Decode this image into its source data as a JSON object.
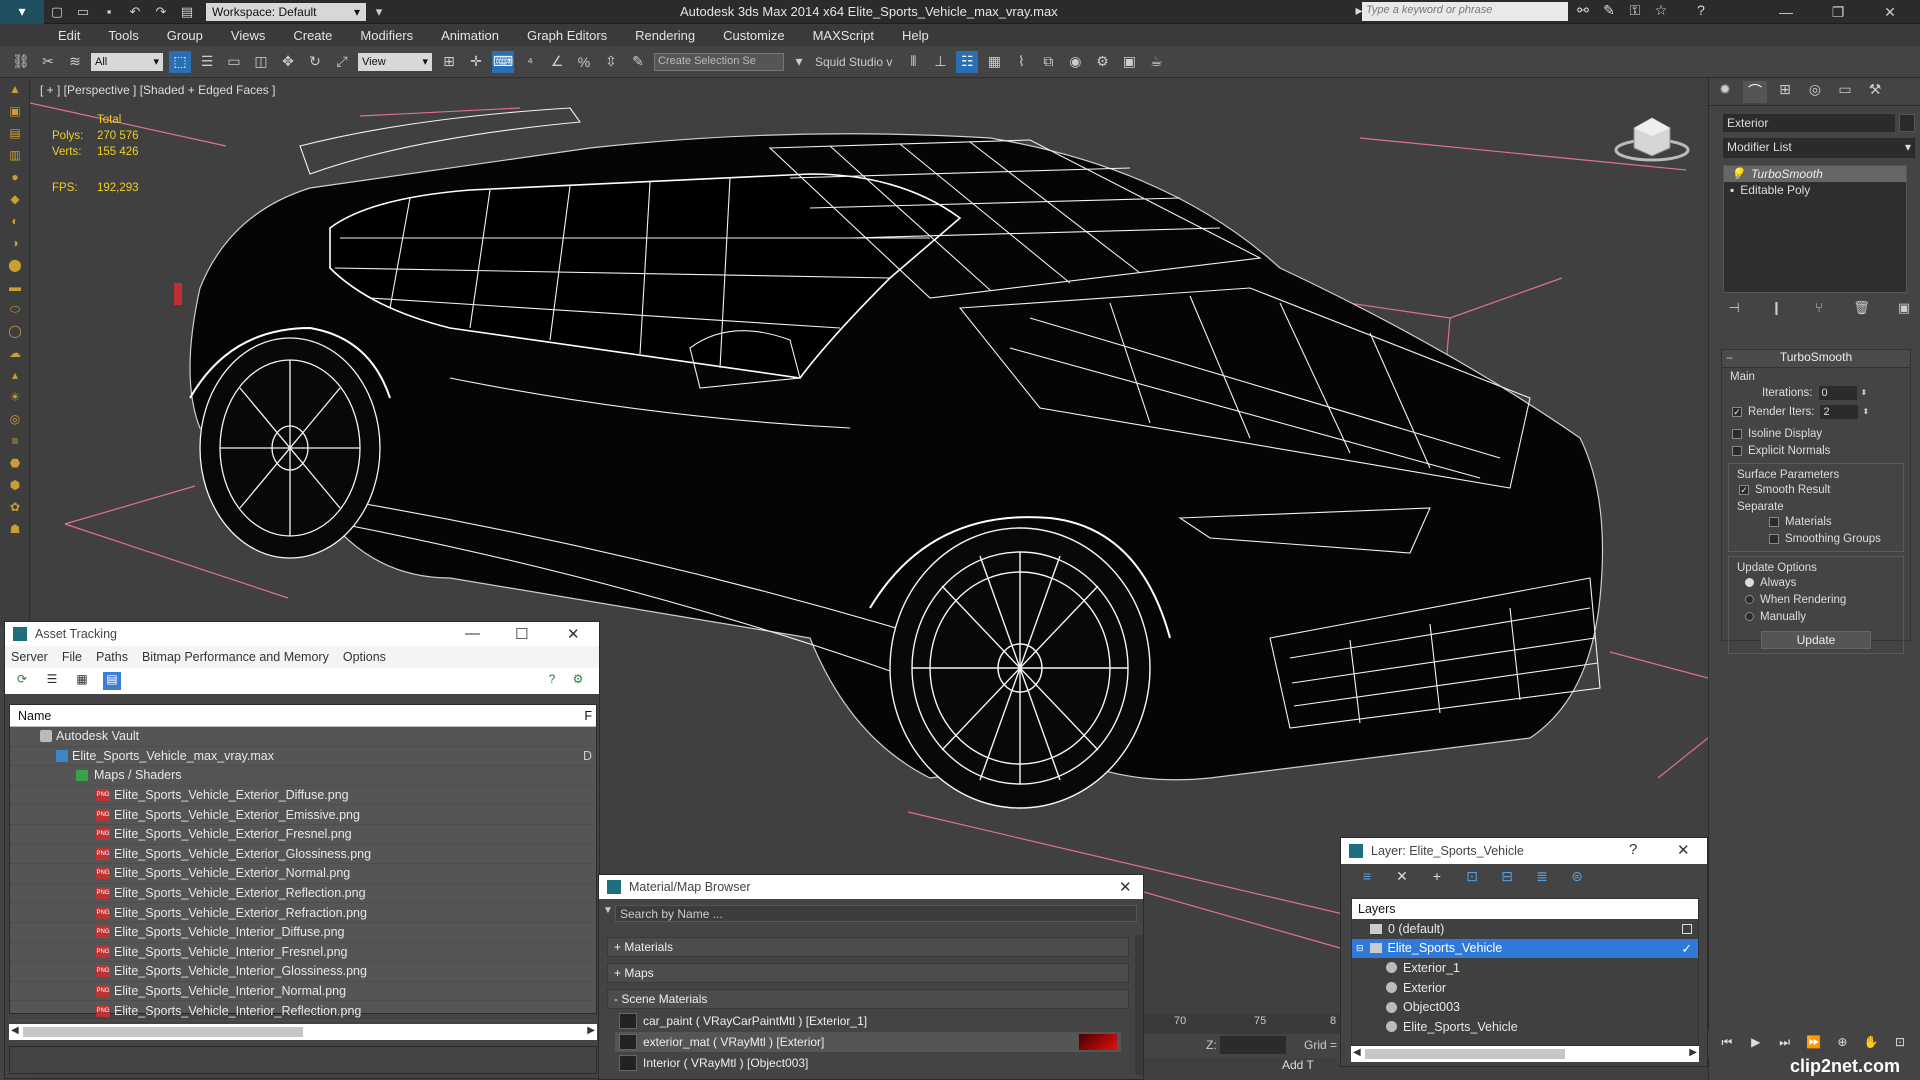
{
  "titlebar": {
    "workspace": "Workspace: Default",
    "window_title": "Autodesk 3ds Max  2014 x64      Elite_Sports_Vehicle_max_vray.max",
    "search_placeholder": "Type a keyword or phrase"
  },
  "menu": [
    "Edit",
    "Tools",
    "Group",
    "Views",
    "Create",
    "Modifiers",
    "Animation",
    "Graph Editors",
    "Rendering",
    "Customize",
    "MAXScript",
    "Help"
  ],
  "toolbar": {
    "filter": "All",
    "ref_coord": "View",
    "selection_set": "Create Selection Se",
    "squid": "Squid Studio v"
  },
  "viewport": {
    "label": "[ + ] [Perspective ] [Shaded + Edged Faces ]",
    "stats_total": "Total",
    "polys_label": "Polys:",
    "polys_value": "270 576",
    "verts_label": "Verts:",
    "verts_value": "155 426",
    "fps_label": "FPS:",
    "fps_value": "192,293"
  },
  "command_panel": {
    "object_name": "Exterior",
    "modifier_list": "Modifier List",
    "stack": [
      "TurboSmooth",
      "Editable Poly"
    ],
    "rollout_title": "TurboSmooth",
    "main_label": "Main",
    "iterations_label": "Iterations:",
    "iterations_value": "0",
    "render_iters_label": "Render Iters:",
    "render_iters_value": "2",
    "isoline_label": "Isoline Display",
    "explicit_label": "Explicit Normals",
    "surface_label": "Surface Parameters",
    "smooth_label": "Smooth Result",
    "separate_label": "Separate",
    "materials_label": "Materials",
    "smoothing_label": "Smoothing Groups",
    "update_options_label": "Update Options",
    "always_label": "Always",
    "when_rendering_label": "When Rendering",
    "manually_label": "Manually",
    "update_button": "Update"
  },
  "asset_tracking": {
    "title": "Asset Tracking",
    "menu": [
      "Server",
      "File",
      "Paths",
      "Bitmap Performance and Memory",
      "Options"
    ],
    "col_name": "Name",
    "col_f": "F",
    "vault": "Autodesk Vault",
    "max_file": "Elite_Sports_Vehicle_max_vray.max",
    "max_tag": "D",
    "maps_folder": "Maps / Shaders",
    "files": [
      "Elite_Sports_Vehicle_Exterior_Diffuse.png",
      "Elite_Sports_Vehicle_Exterior_Emissive.png",
      "Elite_Sports_Vehicle_Exterior_Fresnel.png",
      "Elite_Sports_Vehicle_Exterior_Glossiness.png",
      "Elite_Sports_Vehicle_Exterior_Normal.png",
      "Elite_Sports_Vehicle_Exterior_Reflection.png",
      "Elite_Sports_Vehicle_Exterior_Refraction.png",
      "Elite_Sports_Vehicle_Interior_Diffuse.png",
      "Elite_Sports_Vehicle_Interior_Fresnel.png",
      "Elite_Sports_Vehicle_Interior_Glossiness.png",
      "Elite_Sports_Vehicle_Interior_Normal.png",
      "Elite_Sports_Vehicle_Interior_Reflection.png"
    ]
  },
  "material_browser": {
    "title": "Material/Map Browser",
    "search_placeholder": "Search by Name ...",
    "sections": [
      "+ Materials",
      "+ Maps",
      "- Scene Materials"
    ],
    "materials": [
      "car_paint  ( VRayCarPaintMtl ) [Exterior_1]",
      "exterior_mat  ( VRayMtl ) [Exterior]",
      "Interior  ( VRayMtl ) [Object003]"
    ]
  },
  "timeline": {
    "ticks": [
      "70",
      "75",
      "8"
    ],
    "z_label": "Z:",
    "grid_label": "Grid =",
    "add_time": "Add T"
  },
  "layer_window": {
    "title": "Layer: Elite_Sports_Vehicle",
    "help": "?",
    "layers_header": "Layers",
    "rows": [
      "0 (default)",
      "Elite_Sports_Vehicle",
      "Exterior_1",
      "Exterior",
      "Object003",
      "Elite_Sports_Vehicle"
    ]
  },
  "watermark": "clip2net.com",
  "colors": {
    "accent_blue": "#2f7ad8",
    "stats_yellow": "#f0d020",
    "material_red": "#e01010"
  }
}
